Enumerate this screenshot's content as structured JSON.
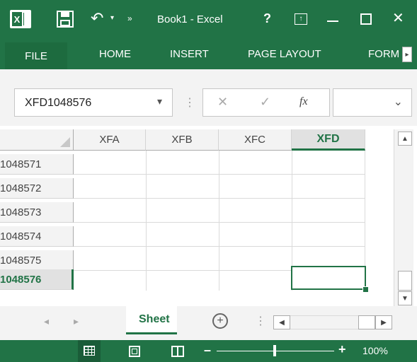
{
  "window": {
    "title": "Book1 - Excel",
    "help": "?",
    "minimize": "–",
    "maximize": "☐",
    "close": "✕"
  },
  "ribbon_tabs": [
    "FILE",
    "HOME",
    "INSERT",
    "PAGE LAYOUT",
    "FORM"
  ],
  "ribbon_more": "▸",
  "namebox": {
    "value": "XFD1048576",
    "dropdown": "▾"
  },
  "formula": {
    "cancel": "✕",
    "enter": "✓",
    "fx": "fx",
    "expand": "⌄"
  },
  "columns": [
    "XFA",
    "XFB",
    "XFC",
    "XFD"
  ],
  "active_column": "XFD",
  "rows": [
    "1048571",
    "1048572",
    "1048573",
    "1048574",
    "1048575",
    "1048576"
  ],
  "active_row": "1048576",
  "sheet": {
    "tab": "Sheet",
    "add": "+",
    "prev": "◂",
    "next": "▸"
  },
  "status": {
    "zoom": "100%",
    "minus": "–",
    "plus": "+"
  },
  "colors": {
    "brand": "#217346",
    "active": "#217346"
  }
}
